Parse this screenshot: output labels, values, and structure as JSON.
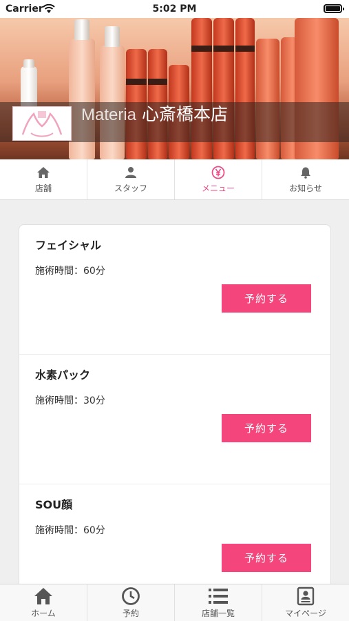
{
  "status_bar": {
    "carrier": "Carrier",
    "time": "5:02 PM"
  },
  "header": {
    "brand": "Materia",
    "salon_name": "心斎橋本店"
  },
  "tabs": [
    {
      "label": "店舗",
      "icon": "home-icon",
      "active": false
    },
    {
      "label": "スタッフ",
      "icon": "person-icon",
      "active": false
    },
    {
      "label": "メニュー",
      "icon": "yen-icon",
      "active": true
    },
    {
      "label": "お知らせ",
      "icon": "bell-icon",
      "active": false
    }
  ],
  "menu": {
    "items": [
      {
        "name": "フェイシャル",
        "duration": "施術時間：60分",
        "button": "予約する"
      },
      {
        "name": "水素パック",
        "duration": "施術時間：30分",
        "button": "予約する"
      },
      {
        "name": "SOU顔",
        "duration": "施術時間：60分",
        "button": "予約する"
      }
    ]
  },
  "bottom_nav": [
    {
      "label": "ホーム",
      "icon": "home-icon"
    },
    {
      "label": "予約",
      "icon": "clock-icon"
    },
    {
      "label": "店舗一覧",
      "icon": "list-icon"
    },
    {
      "label": "マイページ",
      "icon": "profile-card-icon"
    }
  ],
  "colors": {
    "accent": "#f4467d",
    "active_tab": "#ee4a86"
  }
}
